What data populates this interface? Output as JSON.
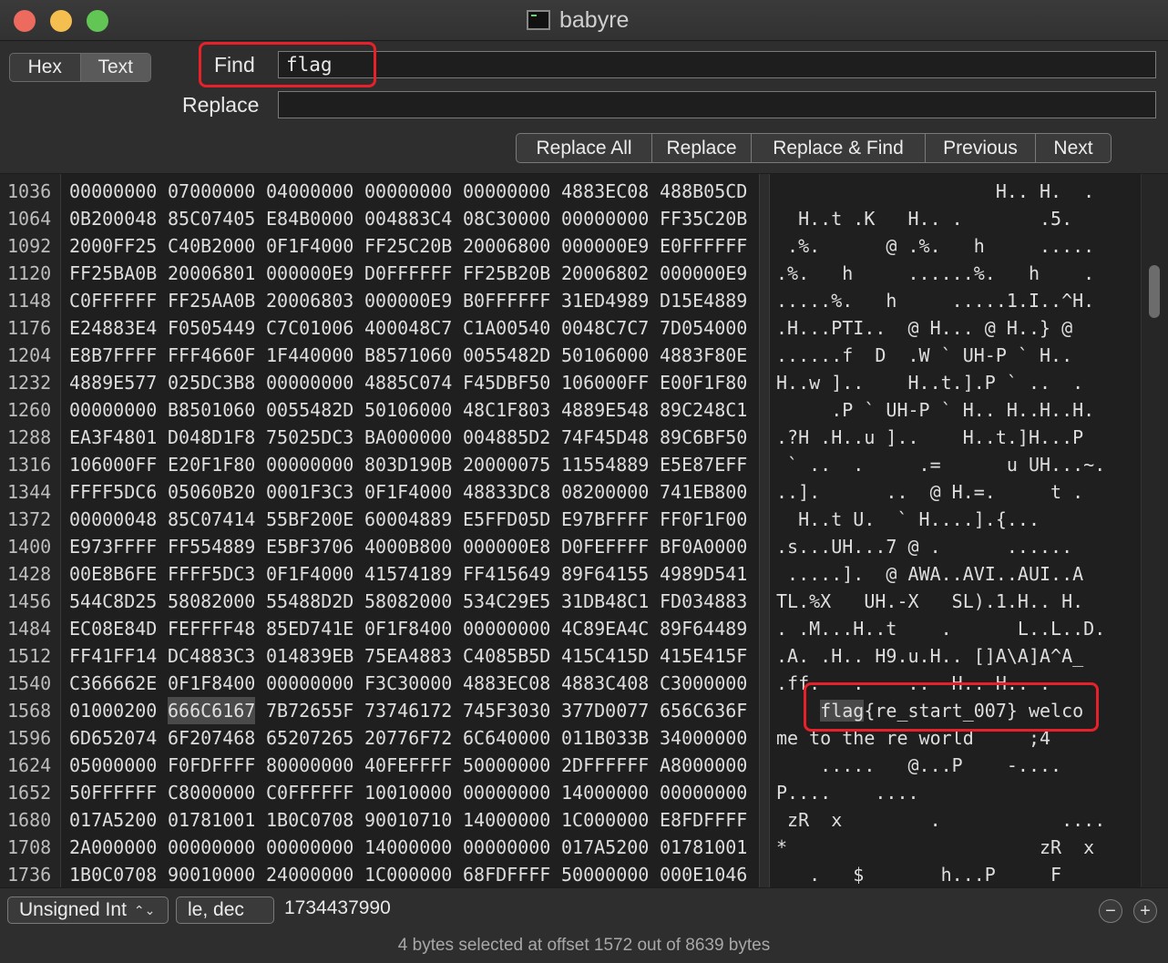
{
  "window": {
    "title": "babyre"
  },
  "mode": {
    "hex_label": "Hex",
    "text_label": "Text",
    "active": "Text"
  },
  "find": {
    "label": "Find",
    "value": "flag"
  },
  "replace": {
    "label": "Replace",
    "value": ""
  },
  "buttons": {
    "replace_all": "Replace All",
    "replace": "Replace",
    "replace_find": "Replace & Find",
    "previous": "Previous",
    "next": "Next"
  },
  "rows": [
    {
      "offset": "1036",
      "words": [
        "00000000",
        "07000000",
        "04000000",
        "00000000",
        "00000000",
        "4883EC08",
        "488B05CD"
      ],
      "text": "                    H.. H.  ."
    },
    {
      "offset": "1064",
      "words": [
        "0B200048",
        "85C07405",
        "E84B0000",
        "004883C4",
        "08C30000",
        "00000000",
        "FF35C20B"
      ],
      "text": "  H..t .K   H.. .       .5."
    },
    {
      "offset": "1092",
      "words": [
        "2000FF25",
        "C40B2000",
        "0F1F4000",
        "FF25C20B",
        "20006800",
        "000000E9",
        "E0FFFFFF"
      ],
      "text": " .%.      @ .%.   h     ....."
    },
    {
      "offset": "1120",
      "words": [
        "FF25BA0B",
        "20006801",
        "000000E9",
        "D0FFFFFF",
        "FF25B20B",
        "20006802",
        "000000E9"
      ],
      "text": ".%.   h     ......%.   h    ."
    },
    {
      "offset": "1148",
      "words": [
        "C0FFFFFF",
        "FF25AA0B",
        "20006803",
        "000000E9",
        "B0FFFFFF",
        "31ED4989",
        "D15E4889"
      ],
      "text": ".....%.   h     .....1.I..^H."
    },
    {
      "offset": "1176",
      "words": [
        "E24883E4",
        "F0505449",
        "C7C01006",
        "400048C7",
        "C1A00540",
        "0048C7C7",
        "7D054000"
      ],
      "text": ".H...PTI..  @ H... @ H..} @"
    },
    {
      "offset": "1204",
      "words": [
        "E8B7FFFF",
        "FFF4660F",
        "1F440000",
        "B8571060",
        "0055482D",
        "50106000",
        "4883F80E"
      ],
      "text": "......f  D  .W ` UH-P ` H.."
    },
    {
      "offset": "1232",
      "words": [
        "4889E577",
        "025DC3B8",
        "00000000",
        "4885C074",
        "F45DBF50",
        "106000FF",
        "E00F1F80"
      ],
      "text": "H..w ]..    H..t.].P ` ..  ."
    },
    {
      "offset": "1260",
      "words": [
        "00000000",
        "B8501060",
        "0055482D",
        "50106000",
        "48C1F803",
        "4889E548",
        "89C248C1"
      ],
      "text": "     .P ` UH-P ` H.. H..H..H."
    },
    {
      "offset": "1288",
      "words": [
        "EA3F4801",
        "D048D1F8",
        "75025DC3",
        "BA000000",
        "004885D2",
        "74F45D48",
        "89C6BF50"
      ],
      "text": ".?H .H..u ]..    H..t.]H...P"
    },
    {
      "offset": "1316",
      "words": [
        "106000FF",
        "E20F1F80",
        "00000000",
        "803D190B",
        "20000075",
        "11554889",
        "E5E87EFF"
      ],
      "text": " ` ..  .     .=      u UH...~."
    },
    {
      "offset": "1344",
      "words": [
        "FFFF5DC6",
        "05060B20",
        "0001F3C3",
        "0F1F4000",
        "48833DC8",
        "08200000",
        "741EB800"
      ],
      "text": "..].      ..  @ H.=.     t ."
    },
    {
      "offset": "1372",
      "words": [
        "00000048",
        "85C07414",
        "55BF200E",
        "60004889",
        "E5FFD05D",
        "E97BFFFF",
        "FF0F1F00"
      ],
      "text": "  H..t U.  ` H....].{..."
    },
    {
      "offset": "1400",
      "words": [
        "E973FFFF",
        "FF554889",
        "E5BF3706",
        "4000B800",
        "000000E8",
        "D0FEFFFF",
        "BF0A0000"
      ],
      "text": ".s...UH...7 @ .      ......"
    },
    {
      "offset": "1428",
      "words": [
        "00E8B6FE",
        "FFFF5DC3",
        "0F1F4000",
        "41574189",
        "FF415649",
        "89F64155",
        "4989D541"
      ],
      "text": " .....].  @ AWA..AVI..AUI..A"
    },
    {
      "offset": "1456",
      "words": [
        "544C8D25",
        "58082000",
        "55488D2D",
        "58082000",
        "534C29E5",
        "31DB48C1",
        "FD034883"
      ],
      "text": "TL.%X   UH.-X   SL).1.H.. H."
    },
    {
      "offset": "1484",
      "words": [
        "EC08E84D",
        "FEFFFF48",
        "85ED741E",
        "0F1F8400",
        "00000000",
        "4C89EA4C",
        "89F64489"
      ],
      "text": ". .M...H..t    .      L..L..D."
    },
    {
      "offset": "1512",
      "words": [
        "FF41FF14",
        "DC4883C3",
        "014839EB",
        "75EA4883",
        "C4085B5D",
        "415C415D",
        "415E415F"
      ],
      "text": ".A. .H.. H9.u.H.. []A\\A]A^A_"
    },
    {
      "offset": "1540",
      "words": [
        "C366662E",
        "0F1F8400",
        "00000000",
        "F3C30000",
        "4883EC08",
        "4883C408",
        "C3000000"
      ],
      "text": ".ff.   .    ..  H.. H.. ."
    },
    {
      "offset": "1568",
      "words": [
        "01000200",
        "666C6167",
        "7B72655F",
        "73746172",
        "745F3030",
        "377D0077",
        "656C636F"
      ],
      "text": "    flag{re_start_007} welco"
    },
    {
      "offset": "1596",
      "words": [
        "6D652074",
        "6F207468",
        "65207265",
        "20776F72",
        "6C640000",
        "011B033B",
        "34000000"
      ],
      "text": "me to the re world     ;4"
    },
    {
      "offset": "1624",
      "words": [
        "05000000",
        "F0FDFFFF",
        "80000000",
        "40FEFFFF",
        "50000000",
        "2DFFFFFF",
        "A8000000"
      ],
      "text": "    .....   @...P    -...."
    },
    {
      "offset": "1652",
      "words": [
        "50FFFFFF",
        "C8000000",
        "C0FFFFFF",
        "10010000",
        "00000000",
        "14000000",
        "00000000"
      ],
      "text": "P....    ...."
    },
    {
      "offset": "1680",
      "words": [
        "017A5200",
        "01781001",
        "1B0C0708",
        "90010710",
        "14000000",
        "1C000000",
        "E8FDFFFF"
      ],
      "text": " zR  x        .           ...."
    },
    {
      "offset": "1708",
      "words": [
        "2A000000",
        "00000000",
        "00000000",
        "14000000",
        "00000000",
        "017A5200",
        "01781001"
      ],
      "text": "*                       zR  x"
    },
    {
      "offset": "1736",
      "words": [
        "1B0C0708",
        "90010000",
        "24000000",
        "1C000000",
        "68FDFFFF",
        "50000000",
        "000E1046"
      ],
      "text": "   .   $       h...P     F"
    }
  ],
  "selection": {
    "row_offset": "1568",
    "word_index": 1,
    "text_match": "flag"
  },
  "inspector": {
    "type": "Unsigned Int",
    "format": "le, dec",
    "value": "1734437990"
  },
  "status": "4 bytes selected at offset 1572 out of 8639 bytes"
}
